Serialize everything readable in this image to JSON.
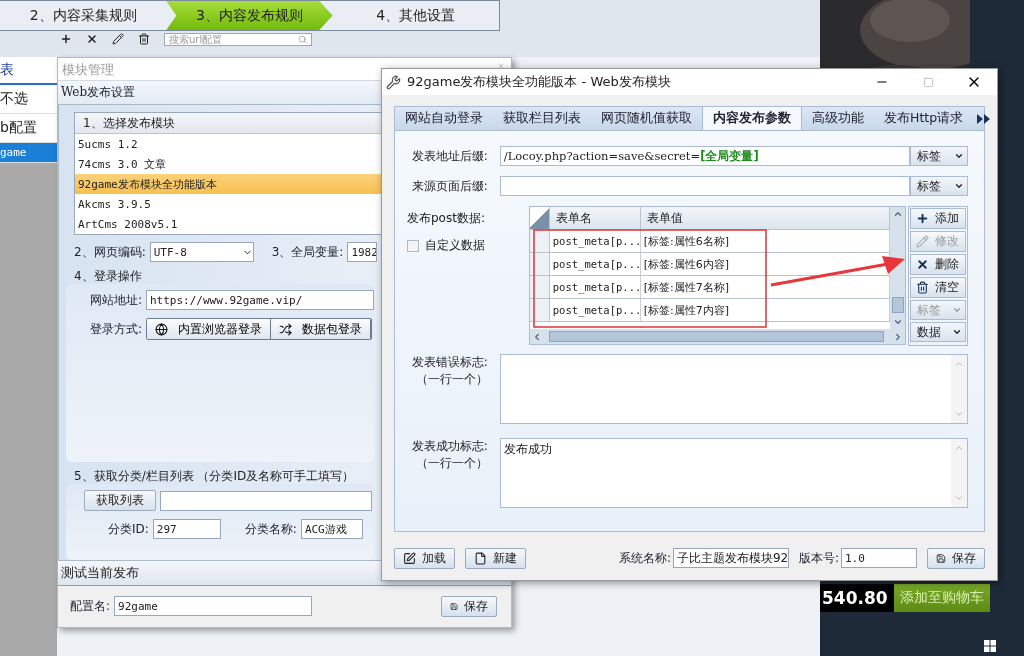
{
  "background_app": {
    "steps": [
      {
        "label": "2、内容采集规则",
        "selected": false
      },
      {
        "label": "3、内容发布规则",
        "selected": true
      },
      {
        "label": "4、其他设置",
        "selected": false
      }
    ],
    "sidebar": {
      "heading": "表",
      "items": [
        {
          "label": "不选",
          "selected": false
        },
        {
          "label": "b配置",
          "selected": false
        },
        {
          "label": "game",
          "selected": true
        }
      ]
    },
    "search": {
      "placeholder": "搜索url配置"
    }
  },
  "module_window": {
    "title": "模块管理",
    "section": "Web发布设置",
    "module_list": {
      "heading": "1、选择发布模块",
      "items": [
        {
          "label": "5ucms 1.2",
          "selected": false
        },
        {
          "label": "74cms 3.0 文章",
          "selected": false
        },
        {
          "label": "92game发布模块全功能版本",
          "selected": true
        },
        {
          "label": "Akcms 3.9.5",
          "selected": false
        },
        {
          "label": "ArtCms 2008v5.1",
          "selected": false
        }
      ]
    },
    "encoding": {
      "label": "2、网页编码:",
      "value": "UTF-8"
    },
    "global_var": {
      "label": "3、全局变量:",
      "value": "1982"
    },
    "login": {
      "heading": "4、登录操作",
      "url_label": "网站地址:",
      "url": "https://www.92game.vip/",
      "method_label": "登录方式:",
      "methods": [
        {
          "label": "内置浏览器登录"
        },
        {
          "label": "数据包登录"
        }
      ]
    },
    "category": {
      "heading": "5、获取分类/栏目列表 （分类ID及名称可手工填写）",
      "fetch_button": "获取列表",
      "id_label": "分类ID:",
      "id": "297",
      "name_label": "分类名称:",
      "name": "ACG游戏"
    },
    "test_bar": "测试当前发布",
    "config_label": "配置名:",
    "config_name": "92game",
    "save": "保存"
  },
  "dialog": {
    "title": "92game发布模块全功能版本 - Web发布模块",
    "tabs": [
      {
        "label": "网站自动登录",
        "selected": false
      },
      {
        "label": "获取栏目列表",
        "selected": false
      },
      {
        "label": "网页随机值获取",
        "selected": false
      },
      {
        "label": "内容发布参数",
        "selected": true
      },
      {
        "label": "高级功能",
        "selected": false
      },
      {
        "label": "发布Http请求",
        "selected": false
      }
    ],
    "fields": [
      {
        "label": "发表地址后缀:",
        "value": "/Locoy.php?action=save&secret=**[全局变量]**",
        "button": "标签"
      },
      {
        "label": "来源页面后缀:",
        "button": "标签"
      }
    ],
    "post": {
      "label": "发布post数据:",
      "custom": {
        "label": "自定义数据",
        "checked": false
      },
      "columns": [
        "表单名",
        "表单值"
      ],
      "rows": [
        {
          "name": "post_meta[p...",
          "value": "[标签:属性6名称]"
        },
        {
          "name": "post_meta[p...",
          "value": "[标签:属性6内容]"
        },
        {
          "name": "post_meta[p...",
          "value": "[标签:属性7名称]"
        },
        {
          "name": "post_meta[p...",
          "value": "[标签:属性7内容]"
        }
      ],
      "actions": [
        {
          "label": "添加",
          "kind": "button",
          "disabled": false
        },
        {
          "label": "修改",
          "kind": "button",
          "disabled": true
        },
        {
          "label": "删除",
          "kind": "button",
          "disabled": false
        },
        {
          "label": "清空",
          "kind": "button",
          "disabled": false
        },
        {
          "label": "标签",
          "kind": "dropdown",
          "disabled": true
        },
        {
          "label": "数据",
          "kind": "dropdown",
          "disabled": false
        }
      ]
    },
    "error_marks": {
      "label": "发表错误标志:",
      "hint": "（一行一个）"
    },
    "success_marks": {
      "label": "发表成功标志:",
      "hint": "（一行一个）",
      "value": "发布成功"
    },
    "footer": {
      "load": "加载",
      "new": "新建",
      "system_name_label": "系统名称:",
      "system_name": "子比主题发布模块92",
      "version_label": "版本号:",
      "version": "1.0",
      "save": "保存"
    }
  },
  "store": {
    "price": "540.80",
    "cart_button": "添加至购物车"
  }
}
